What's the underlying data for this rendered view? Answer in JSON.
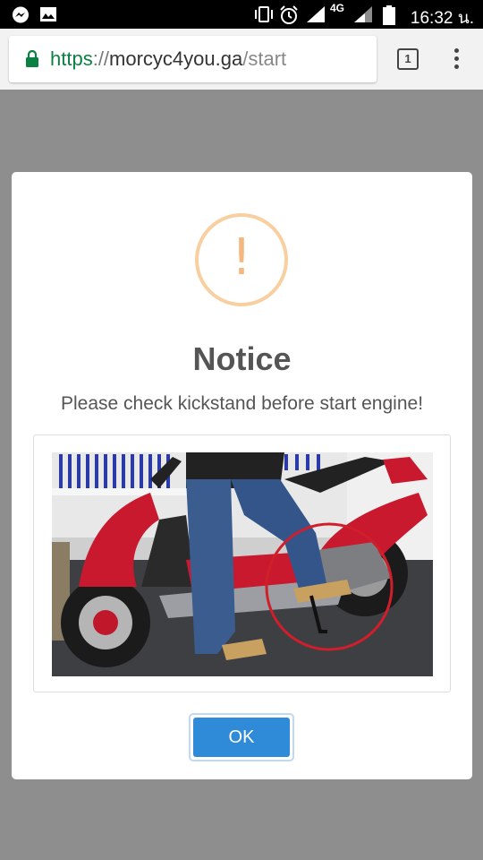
{
  "status_bar": {
    "network": "4G",
    "clock": "16:32 น."
  },
  "browser": {
    "url_scheme": "https",
    "url_sep": "://",
    "url_host": "morcyc4you.ga",
    "url_path": "/start",
    "tab_count": "1"
  },
  "modal": {
    "icon_symbol": "!",
    "title": "Notice",
    "message": "Please check kickstand before start engine!",
    "ok_label": "OK"
  },
  "colors": {
    "accent": "#2f8ad8",
    "warning": "#f4b77e",
    "secure": "#0b8043"
  }
}
